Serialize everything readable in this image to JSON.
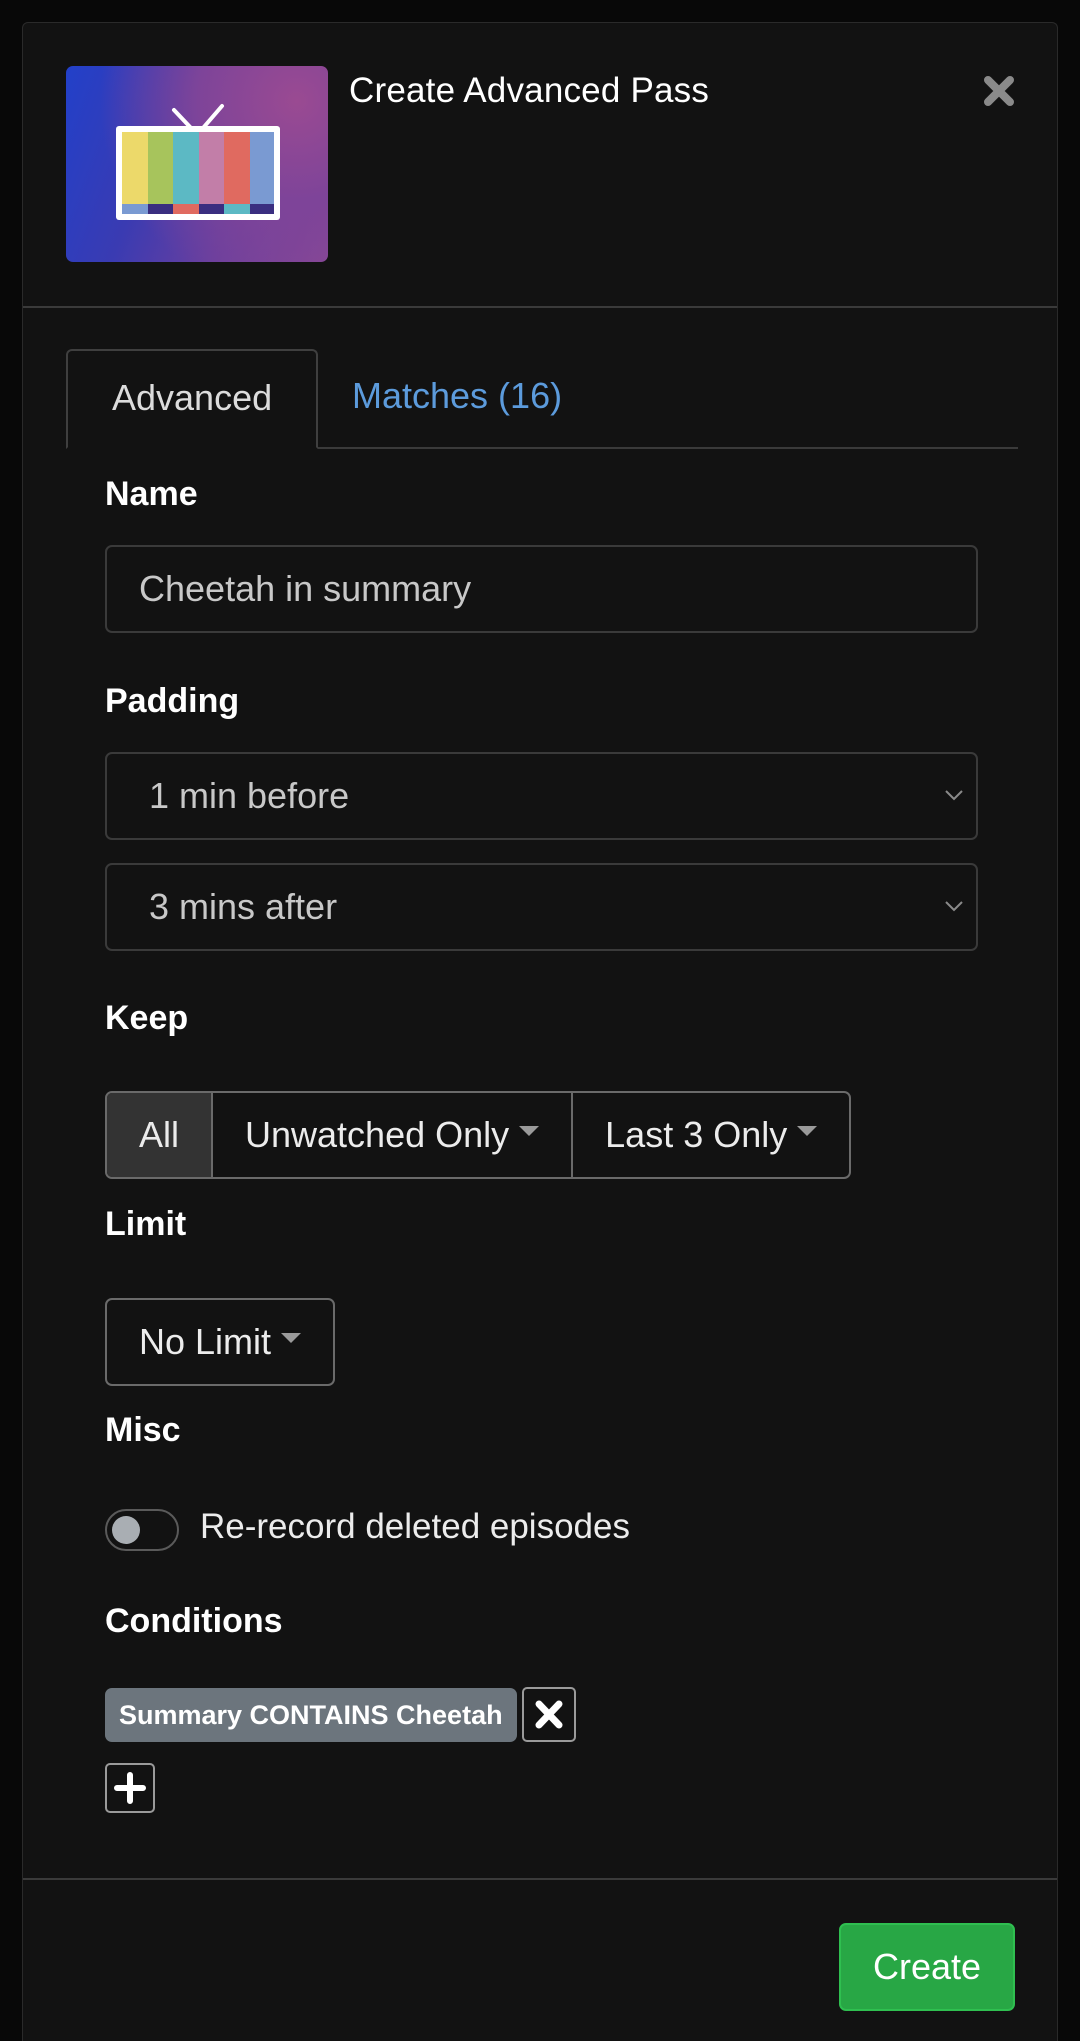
{
  "header": {
    "title": "Create Advanced Pass",
    "thumbnail_icon": "tv-color-bars-icon",
    "close_icon": "close-icon"
  },
  "tabs": [
    {
      "label": "Advanced",
      "active": true
    },
    {
      "label": "Matches (16)",
      "active": false
    }
  ],
  "form": {
    "name": {
      "label": "Name",
      "value": "Cheetah in summary"
    },
    "padding": {
      "label": "Padding",
      "before": "1 min before",
      "after": "3 mins after"
    },
    "keep": {
      "label": "Keep",
      "options": [
        "All",
        "Unwatched Only",
        "Last 3 Only"
      ],
      "selected": "All"
    },
    "limit": {
      "label": "Limit",
      "value": "No Limit"
    },
    "misc": {
      "label": "Misc",
      "rerecord_label": "Re-record deleted episodes",
      "rerecord_enabled": false
    },
    "conditions": {
      "label": "Conditions",
      "items": [
        {
          "text": "Summary CONTAINS Cheetah"
        }
      ]
    }
  },
  "footer": {
    "create_label": "Create"
  },
  "colors": {
    "background": "#121212",
    "accent_link": "#5c9bdc",
    "chip": "#6c757d",
    "create": "#28a745"
  }
}
